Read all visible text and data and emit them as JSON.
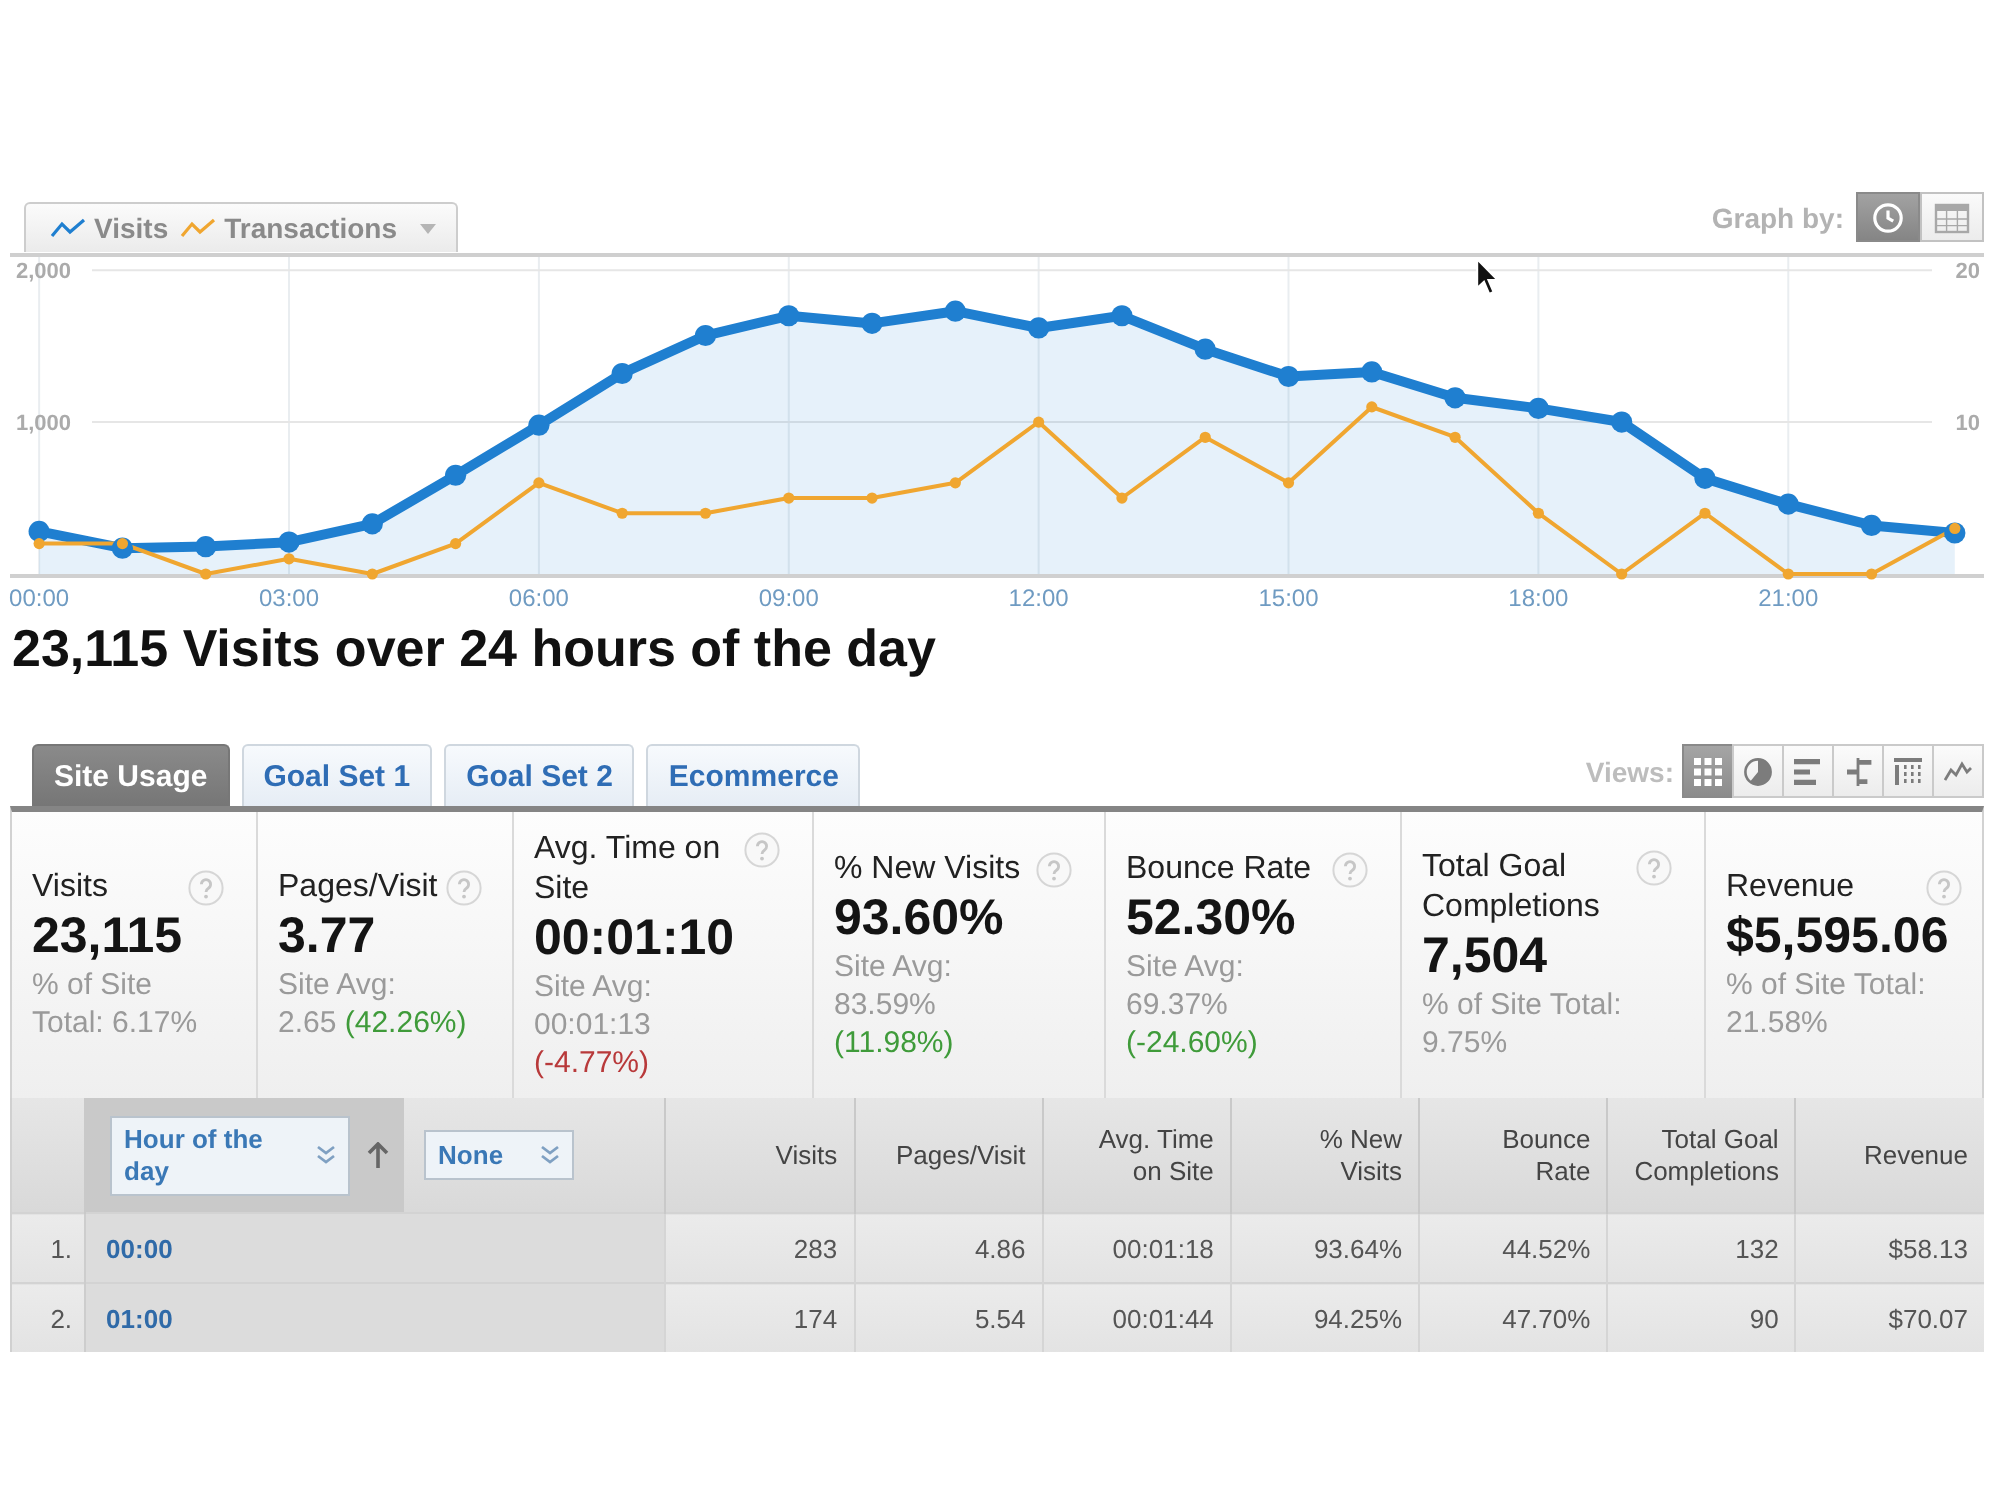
{
  "toolbar": {
    "graph_by_label": "Graph by:",
    "graph_by_options": [
      {
        "kind": "clock",
        "selected": true
      },
      {
        "kind": "calendar",
        "selected": false
      }
    ]
  },
  "chart": {
    "chart_data": {
      "type": "line",
      "grid": true,
      "x": [
        0,
        1,
        2,
        3,
        4,
        5,
        6,
        7,
        8,
        9,
        10,
        11,
        12,
        13,
        14,
        15,
        16,
        17,
        18,
        19,
        20,
        21,
        22,
        23
      ],
      "xlim": [
        -0.35,
        23.35
      ],
      "xticks": [
        {
          "value": 0,
          "label": "00:00"
        },
        {
          "value": 3,
          "label": "03:00"
        },
        {
          "value": 6,
          "label": "06:00"
        },
        {
          "value": 9,
          "label": "09:00"
        },
        {
          "value": 12,
          "label": "12:00"
        },
        {
          "value": 15,
          "label": "15:00"
        },
        {
          "value": 18,
          "label": "18:00"
        },
        {
          "value": 21,
          "label": "21:00"
        }
      ],
      "ylim": [
        0,
        2100
      ],
      "yticks": [
        {
          "value": 1000,
          "label": "1,000"
        },
        {
          "value": 2000,
          "label": "2,000"
        }
      ],
      "y2lim": [
        0,
        21
      ],
      "y2ticks": [
        {
          "value": 10,
          "label": "10"
        },
        {
          "value": 20,
          "label": "20"
        }
      ],
      "series": [
        {
          "name": "Visits",
          "color": "#1f7fd0",
          "type": "area",
          "marker": "circle",
          "values": [
            280,
            170,
            180,
            210,
            330,
            650,
            980,
            1320,
            1570,
            1700,
            1650,
            1730,
            1620,
            1700,
            1480,
            1300,
            1330,
            1160,
            1090,
            1000,
            630,
            460,
            320,
            270
          ]
        },
        {
          "name": "Transactions",
          "color": "#f0a630",
          "type": "line",
          "marker": "circle",
          "axis": "y2",
          "values": [
            2,
            2,
            0,
            1,
            0,
            2,
            6,
            4,
            4,
            5,
            5,
            6,
            10,
            5,
            9,
            6,
            11,
            9,
            4,
            0,
            4,
            0,
            0,
            3
          ]
        }
      ]
    }
  },
  "summary_title": "23,115 Visits over 24 hours of the day",
  "tabs": [
    {
      "label": "Site Usage",
      "selected": true
    },
    {
      "label": "Goal Set 1",
      "selected": false
    },
    {
      "label": "Goal Set 2",
      "selected": false
    },
    {
      "label": "Ecommerce",
      "selected": false
    }
  ],
  "views": {
    "label": "Views:",
    "options": [
      {
        "kind": "table",
        "selected": true
      },
      {
        "kind": "pie",
        "selected": false
      },
      {
        "kind": "bar",
        "selected": false
      },
      {
        "kind": "comparison",
        "selected": false
      },
      {
        "kind": "pivot",
        "selected": false
      },
      {
        "kind": "sparkline",
        "selected": false
      }
    ]
  },
  "metrics": [
    {
      "label": "Visits",
      "value": "23,115",
      "compare_label": "% of Site Total:",
      "compare_value": "6.17%"
    },
    {
      "label": "Pages/Visit",
      "value": "3.77",
      "compare_label": "Site Avg:",
      "compare_value": "2.65",
      "change": "(42.26%)",
      "favorable": true
    },
    {
      "label": "Avg. Time on Site",
      "value": "00:01:10",
      "compare_label": "Site Avg:",
      "compare_value": "00:01:13",
      "change": "(-4.77%)",
      "favorable": false
    },
    {
      "label": "% New Visits",
      "value": "93.60%",
      "compare_label": "Site Avg:",
      "compare_value": "83.59%",
      "change": "(11.98%)",
      "favorable": true
    },
    {
      "label": "Bounce Rate",
      "value": "52.30%",
      "compare_label": "Site Avg:",
      "compare_value": "69.37%",
      "change": "(-24.60%)",
      "favorable": true
    },
    {
      "label": "Total Goal Completions",
      "value": "7,504",
      "compare_label": "% of Site Total:",
      "compare_value": "9.75%"
    },
    {
      "label": "Revenue",
      "value": "$5,595.06",
      "compare_label": "% of Site Total:",
      "compare_value": "21.58%"
    }
  ],
  "table": {
    "primary_dimension": "Hour of the day",
    "sort_ascending": true,
    "secondary_dimension": "None",
    "columns": [
      "Visits",
      "Pages/Visit",
      "Avg. Time on Site",
      "% New Visits",
      "Bounce Rate",
      "Total Goal Completions",
      "Revenue"
    ],
    "rows": [
      {
        "rank": "1.",
        "hour": "00:00",
        "values": [
          "283",
          "4.86",
          "00:01:18",
          "93.64%",
          "44.52%",
          "132",
          "$58.13"
        ]
      },
      {
        "rank": "2.",
        "hour": "01:00",
        "values": [
          "174",
          "5.54",
          "00:01:44",
          "94.25%",
          "47.70%",
          "90",
          "$70.07"
        ]
      }
    ]
  }
}
